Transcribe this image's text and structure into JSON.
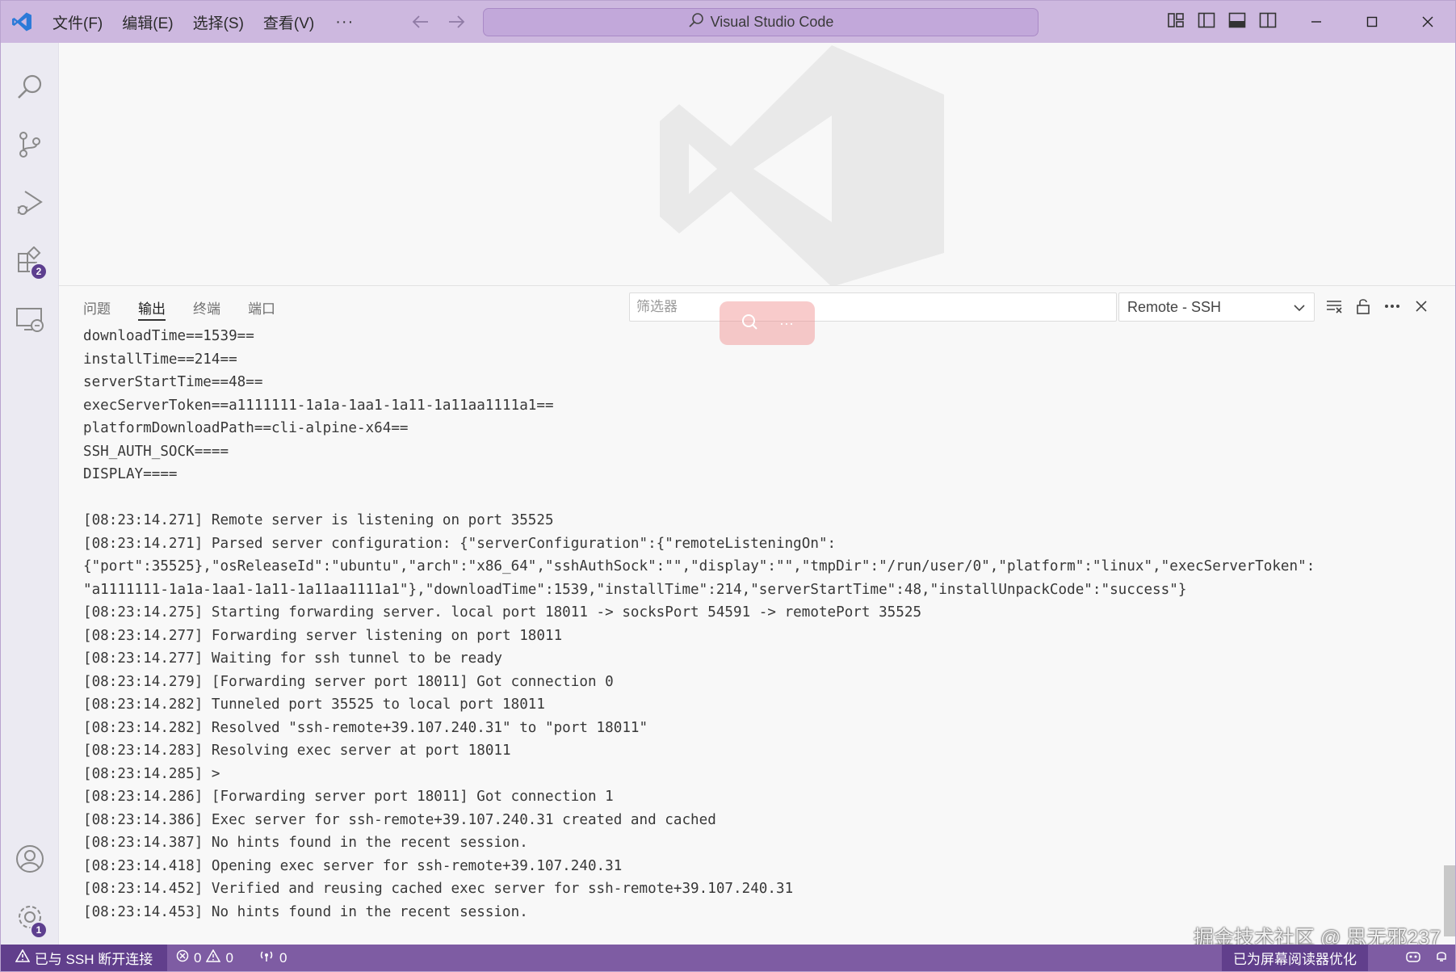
{
  "titlebar": {
    "menus": [
      "文件(F)",
      "编辑(E)",
      "选择(S)",
      "查看(V)"
    ],
    "more": "···",
    "search_label": "Visual Studio Code"
  },
  "activity": {
    "extensions_badge": "2",
    "settings_badge": "1"
  },
  "panel": {
    "tabs": [
      "问题",
      "输出",
      "终端",
      "端口"
    ],
    "active_tab": "输出",
    "filter_placeholder": "筛选器",
    "find_more": "···",
    "channel": "Remote - SSH",
    "output_lines": [
      "downloadTime==1539==",
      "installTime==214==",
      "serverStartTime==48==",
      "execServerToken==a1111111-1a1a-1aa1-1a11-1a11aa1111a1==",
      "platformDownloadPath==cli-alpine-x64==",
      "SSH_AUTH_SOCK====",
      "DISPLAY====",
      "",
      "[08:23:14.271] Remote server is listening on port 35525",
      "[08:23:14.271] Parsed server configuration: {\"serverConfiguration\":{\"remoteListeningOn\":",
      "{\"port\":35525},\"osReleaseId\":\"ubuntu\",\"arch\":\"x86_64\",\"sshAuthSock\":\"\",\"display\":\"\",\"tmpDir\":\"/run/user/0\",\"platform\":\"linux\",\"execServerToken\":",
      "\"a1111111-1a1a-1aa1-1a11-1a11aa1111a1\"},\"downloadTime\":1539,\"installTime\":214,\"serverStartTime\":48,\"installUnpackCode\":\"success\"}",
      "[08:23:14.275] Starting forwarding server. local port 18011 -> socksPort 54591 -> remotePort 35525",
      "[08:23:14.277] Forwarding server listening on port 18011",
      "[08:23:14.277] Waiting for ssh tunnel to be ready",
      "[08:23:14.279] [Forwarding server port 18011] Got connection 0",
      "[08:23:14.282] Tunneled port 35525 to local port 18011",
      "[08:23:14.282] Resolved \"ssh-remote+39.107.240.31\" to \"port 18011\"",
      "[08:23:14.283] Resolving exec server at port 18011",
      "[08:23:14.285] >",
      "[08:23:14.286] [Forwarding server port 18011] Got connection 1",
      "[08:23:14.386] Exec server for ssh-remote+39.107.240.31 created and cached",
      "[08:23:14.387] No hints found in the recent session.",
      "[08:23:14.418] Opening exec server for ssh-remote+39.107.240.31",
      "[08:23:14.452] Verified and reusing cached exec server for ssh-remote+39.107.240.31",
      "[08:23:14.453] No hints found in the recent session."
    ],
    "watermark": "掘金技术社区 @ 思无邪237"
  },
  "statusbar": {
    "remote": "已与 SSH 断开连接",
    "errors": "0",
    "warnings": "0",
    "ports": "0",
    "screen_reader": "已为屏幕阅读器优化"
  },
  "colors": {
    "titlebar": "#cdb8df",
    "statusbar": "#7e5ca3",
    "statusbar_remote": "#613f8c",
    "vscode_blue": "#2b7ad8"
  }
}
